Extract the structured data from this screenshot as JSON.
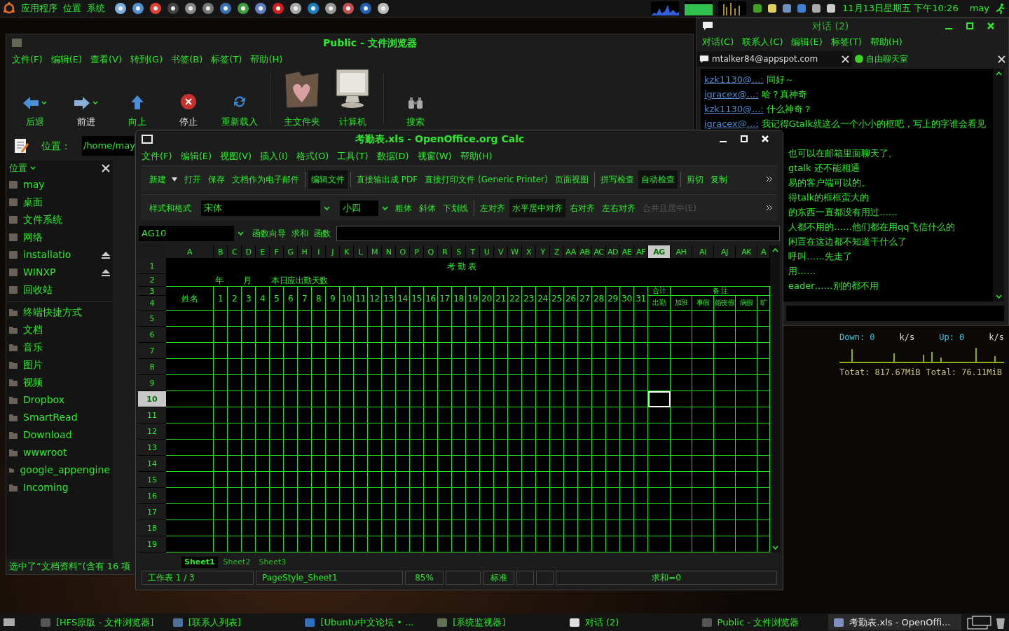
{
  "top_panel": {
    "menus": [
      "应用程序",
      "位置",
      "系统"
    ],
    "clock": "11月13日星期五 下午10:26",
    "user": "may"
  },
  "file_browser": {
    "title": "Public - 文件浏览器",
    "menu": [
      "文件(F)",
      "编辑(E)",
      "查看(V)",
      "转到(G)",
      "书签(B)",
      "标签(T)",
      "帮助(H)"
    ],
    "toolbar": [
      {
        "label": "后退",
        "kind": "back"
      },
      {
        "label": "前进",
        "kind": "forward"
      },
      {
        "label": "向上",
        "kind": "up"
      },
      {
        "label": "停止",
        "kind": "stop"
      },
      {
        "label": "重新载入",
        "kind": "reload"
      },
      {
        "label": "主文件夹",
        "kind": "home"
      },
      {
        "label": "计算机",
        "kind": "computer"
      },
      {
        "label": "搜索",
        "kind": "search"
      }
    ],
    "location_label": "位置：",
    "location_value": "/home/may",
    "sidebar_title": "位置",
    "places": [
      {
        "label": "may",
        "eject": false
      },
      {
        "label": "桌面",
        "eject": false
      },
      {
        "label": "文件系统",
        "eject": false
      },
      {
        "label": "网络",
        "eject": false
      },
      {
        "label": "installatio",
        "eject": true
      },
      {
        "label": "WINXP",
        "eject": true
      },
      {
        "label": "回收站",
        "eject": false
      }
    ],
    "bookmarks": [
      "终端快捷方式",
      "文档",
      "音乐",
      "图片",
      "视频",
      "Dropbox",
      "SmartRead",
      "Download",
      "wwwroot",
      "google_appengine",
      "Incoming"
    ],
    "status": "选中了“文档资料”(含有 16 项"
  },
  "chat": {
    "title": "对话 (2)",
    "menu": [
      "对话(C)",
      "联系人(C)",
      "编辑(E)",
      "标签(T)",
      "帮助(H)"
    ],
    "tabs": [
      {
        "label": "mtalker84@appspot.com",
        "kind": "chat",
        "selected": true
      },
      {
        "label": "自由聊天室",
        "kind": "room",
        "selected": false
      }
    ],
    "messages": [
      {
        "sender": "kzk1130@...:",
        "text": "同好～"
      },
      {
        "sender": "igracex@...:",
        "text": "哈？真神奇"
      },
      {
        "sender": "kzk1130@...:",
        "text": "什么神奇？"
      },
      {
        "sender": "igracex@...:",
        "text": "我记得Gtalk就这么一个小小的框吧，写上的字谁会看见"
      }
    ],
    "fragments": [
      "也可以在邮箱里面聊天了。",
      "gtalk 还不能相通",
      "易的客户端可以的。",
      "得talk的框框蛮大的",
      "的东西一直都没有用过……",
      "人都不用的……他们都在用qq飞信什么的",
      "闲置在这边都不知道干什么了",
      "呼叫……先走了",
      "用……",
      "eader……别的都不用"
    ]
  },
  "net_monitor": {
    "down": "Down: 0",
    "down_unit": "k/s",
    "up": "Up: 0",
    "up_unit": "k/s",
    "total_down": "Totat: 817.67MiB",
    "total_up": "Total: 76.11MiB"
  },
  "calc": {
    "title": "考勤表.xls - OpenOffice.org Calc",
    "menu": [
      "文件(F)",
      "编辑(E)",
      "视图(V)",
      "插入(I)",
      "格式(O)",
      "工具(T)",
      "数据(D)",
      "视窗(W)",
      "帮助(H)"
    ],
    "toolbar": [
      {
        "label": "新建",
        "kind": "dropdown",
        "pressed": false
      },
      {
        "label": "打开",
        "kind": "button",
        "pressed": false
      },
      {
        "label": "保存",
        "kind": "button",
        "pressed": false
      },
      {
        "label": "文档作为电子邮件",
        "kind": "button",
        "pressed": false
      },
      {
        "label": "编辑文件",
        "kind": "button",
        "pressed": true
      },
      {
        "label": "直接输出成 PDF",
        "kind": "button",
        "pressed": false
      },
      {
        "label": "直接打印文件 (Generic Printer)",
        "kind": "button",
        "pressed": false
      },
      {
        "label": "页面视图",
        "kind": "button",
        "pressed": false
      },
      {
        "label": "拼写检查",
        "kind": "button",
        "pressed": false
      },
      {
        "label": "自动检查",
        "kind": "button",
        "pressed": true
      },
      {
        "label": "剪切",
        "kind": "button",
        "pressed": false
      },
      {
        "label": "复制",
        "kind": "button",
        "pressed": false
      }
    ],
    "format_bar": {
      "styles": "样式和格式",
      "font": "宋体",
      "size": "小四",
      "buttons": [
        {
          "label": "粗体",
          "pressed": false,
          "disabled": false
        },
        {
          "label": "斜体",
          "pressed": false,
          "disabled": false
        },
        {
          "label": "下划线",
          "pressed": false,
          "disabled": false
        },
        {
          "label": "左对齐",
          "pressed": false,
          "disabled": false
        },
        {
          "label": "水平居中对齐",
          "pressed": true,
          "disabled": false
        },
        {
          "label": "右对齐",
          "pressed": false,
          "disabled": false
        },
        {
          "label": "左右对齐",
          "pressed": false,
          "disabled": false
        },
        {
          "label": "合并且居中(E)",
          "pressed": false,
          "disabled": true
        }
      ]
    },
    "formula_bar": {
      "cell": "AG10",
      "buttons": [
        "函数向导",
        "求和",
        "函数"
      ]
    },
    "columns": [
      {
        "label": "A",
        "selected": false
      },
      {
        "label": "B",
        "selected": false
      },
      {
        "label": "C",
        "selected": false
      },
      {
        "label": "D",
        "selected": false
      },
      {
        "label": "E",
        "selected": false
      },
      {
        "label": "F",
        "selected": false
      },
      {
        "label": "G",
        "selected": false
      },
      {
        "label": "H",
        "selected": false
      },
      {
        "label": "I",
        "selected": false
      },
      {
        "label": "J",
        "selected": false
      },
      {
        "label": "K",
        "selected": false
      },
      {
        "label": "L",
        "selected": false
      },
      {
        "label": "M",
        "selected": false
      },
      {
        "label": "N",
        "selected": false
      },
      {
        "label": "O",
        "selected": false
      },
      {
        "label": "P",
        "selected": false
      },
      {
        "label": "Q",
        "selected": false
      },
      {
        "label": "R",
        "selected": false
      },
      {
        "label": "S",
        "selected": false
      },
      {
        "label": "T",
        "selected": false
      },
      {
        "label": "U",
        "selected": false
      },
      {
        "label": "V",
        "selected": false
      },
      {
        "label": "W",
        "selected": false
      },
      {
        "label": "X",
        "selected": false
      },
      {
        "label": "Y",
        "selected": false
      },
      {
        "label": "Z",
        "selected": false
      },
      {
        "label": "AA",
        "selected": false
      },
      {
        "label": "AB",
        "selected": false
      },
      {
        "label": "AC",
        "selected": false
      },
      {
        "label": "AD",
        "selected": false
      },
      {
        "label": "AE",
        "selected": false
      },
      {
        "label": "AF",
        "selected": false
      },
      {
        "label": "AG",
        "selected": true
      },
      {
        "label": "AH",
        "selected": false
      },
      {
        "label": "AI",
        "selected": false
      },
      {
        "label": "AJ",
        "selected": false
      },
      {
        "label": "AK",
        "selected": false
      },
      {
        "label": "A",
        "selected": false
      }
    ],
    "rows": [
      {
        "label": "1",
        "selected": false
      },
      {
        "label": "2",
        "selected": false
      },
      {
        "label": "3",
        "selected": false
      },
      {
        "label": "4",
        "selected": false
      },
      {
        "label": "5",
        "selected": false
      },
      {
        "label": "6",
        "selected": false
      },
      {
        "label": "7",
        "selected": false
      },
      {
        "label": "8",
        "selected": false
      },
      {
        "label": "9",
        "selected": false
      },
      {
        "label": "10",
        "selected": true
      },
      {
        "label": "11",
        "selected": false
      },
      {
        "label": "12",
        "selected": false
      },
      {
        "label": "13",
        "selected": false
      },
      {
        "label": "14",
        "selected": false
      },
      {
        "label": "15",
        "selected": false
      },
      {
        "label": "16",
        "selected": false
      },
      {
        "label": "17",
        "selected": false
      },
      {
        "label": "18",
        "selected": false
      },
      {
        "label": "19",
        "selected": false
      }
    ],
    "sheet": {
      "title": "考 勤 表",
      "info": [
        "年",
        "月",
        "本日应出勤天数"
      ],
      "name_header": "姓名",
      "days": [
        "1",
        "2",
        "3",
        "4",
        "5",
        "6",
        "7",
        "8",
        "9",
        "10",
        "11",
        "12",
        "13",
        "14",
        "15",
        "16",
        "17",
        "18",
        "19",
        "20",
        "21",
        "22",
        "23",
        "24",
        "25",
        "26",
        "27",
        "28",
        "29",
        "30",
        "31"
      ],
      "total_header": "合计",
      "remarks_header": "备 注",
      "attendance_header": "出勤",
      "remark_columns": [
        "加班",
        "事假",
        "婚丧假",
        "病假",
        "旷"
      ]
    },
    "sheets": [
      {
        "label": "Sheet1",
        "selected": true
      },
      {
        "label": "Sheet2",
        "selected": false
      },
      {
        "label": "Sheet3",
        "selected": false
      }
    ],
    "status": [
      "工作表 1 / 3",
      "PageStyle_Sheet1",
      "85%",
      "标准",
      "求和=0"
    ]
  },
  "taskbar": [
    {
      "label": "[HFS原版 - 文件浏览器]",
      "kind": "files",
      "selected": false
    },
    {
      "label": "[联系人列表]",
      "kind": "contacts",
      "selected": false
    },
    {
      "label": "[Ubuntu中文论坛 • ...",
      "kind": "web",
      "selected": false
    },
    {
      "label": "[系统监视器]",
      "kind": "monitor",
      "selected": false
    },
    {
      "label": "对话 (2)",
      "kind": "chat",
      "selected": false
    },
    {
      "label": "Public - 文件浏览器",
      "kind": "files",
      "selected": false
    },
    {
      "label": "考勤表.xls - OpenOffi...",
      "kind": "sheet",
      "selected": true
    }
  ]
}
